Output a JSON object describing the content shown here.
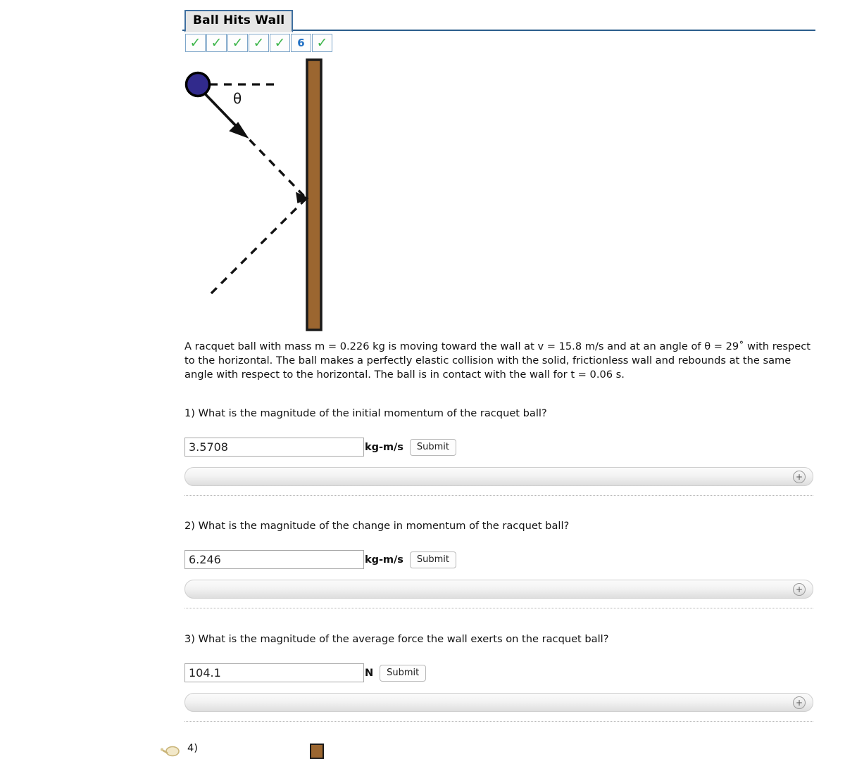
{
  "tab": {
    "title": "Ball Hits Wall"
  },
  "progress": {
    "items": [
      {
        "type": "check",
        "label": "✓"
      },
      {
        "type": "check",
        "label": "✓"
      },
      {
        "type": "check",
        "label": "✓"
      },
      {
        "type": "check",
        "label": "✓"
      },
      {
        "type": "check",
        "label": "✓"
      },
      {
        "type": "number",
        "label": "6"
      },
      {
        "type": "check",
        "label": "✓"
      }
    ],
    "check_color": "#3cb54a",
    "number_color": "#1f6fc4"
  },
  "figure": {
    "name": "ball-hits-wall-diagram",
    "angle_label": "θ",
    "ball_color": "#312a8c",
    "ball_outline": "#000000",
    "wall_fill": "#9b6630",
    "wall_outline": "#1a1a1a"
  },
  "problem": {
    "statement": "A racquet ball with mass m = 0.226 kg is moving toward the wall at v = 15.8 m/s and at an angle of θ = 29˚ with respect to the horizontal. The ball makes a perfectly elastic collision with the solid, frictionless wall and rebounds at the same angle with respect to the horizontal. The ball is in contact with the wall for t = 0.06 s."
  },
  "questions": [
    {
      "prompt": "1) What is the magnitude of the initial momentum of the racquet ball?",
      "value": "3.5708",
      "placeholder": "",
      "unit": "kg-m/s",
      "submit_label": "Submit",
      "expand_label": "+"
    },
    {
      "prompt": "2) What is the magnitude of the change in momentum of the racquet ball?",
      "value": "6.246",
      "placeholder": "",
      "unit": "kg-m/s",
      "submit_label": "Submit",
      "expand_label": "+"
    },
    {
      "prompt": "3) What is the magnitude of the average force the wall exerts on the racquet ball?",
      "value": "104.1",
      "placeholder": "",
      "unit": "N",
      "submit_label": "Submit",
      "expand_label": "+"
    }
  ],
  "bottom": {
    "q4_label": "4)"
  }
}
